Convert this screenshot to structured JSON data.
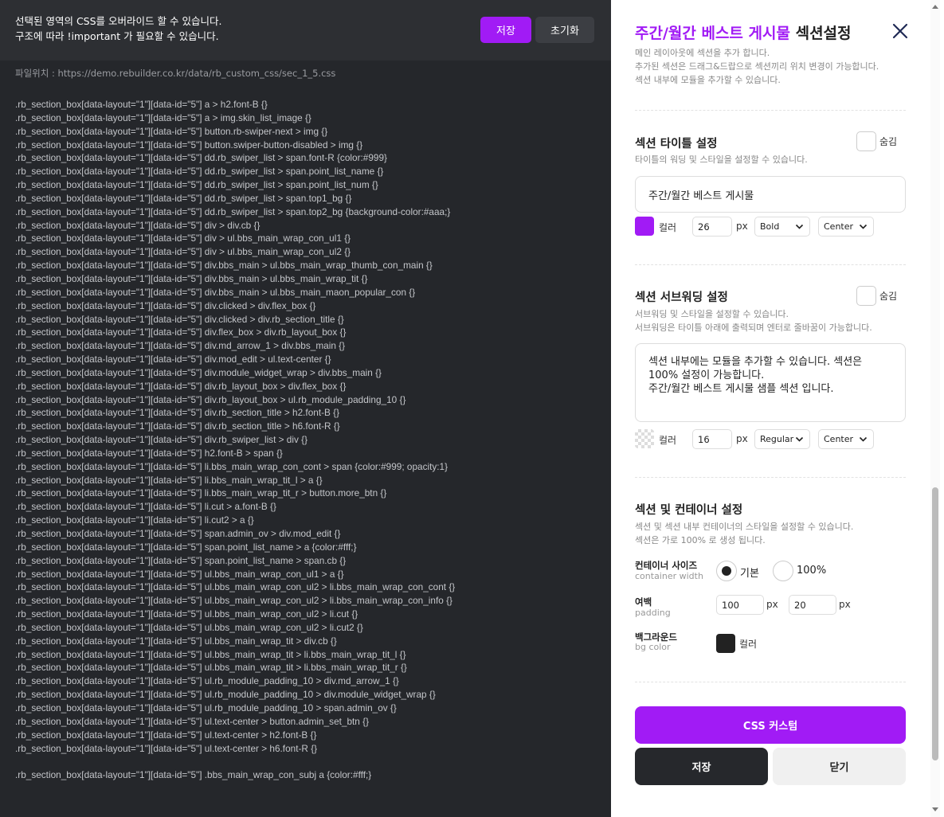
{
  "editor": {
    "notice_line1": "선택된 영역의 CSS를 오버라이드 할 수 있습니다.",
    "notice_line2": "구조에 따라 !important 가 필요할 수 있습니다.",
    "save_label": "저장",
    "reset_label": "초기화",
    "filepath": "파일위치 : https://demo.rebuilder.co.kr/data/rb_custom_css/sec_1_5.css",
    "code_lines": [
      ".rb_section_box[data-layout=\"1\"][data-id=\"5\"] a > h2.font-B {}",
      ".rb_section_box[data-layout=\"1\"][data-id=\"5\"] a > img.skin_list_image {}",
      ".rb_section_box[data-layout=\"1\"][data-id=\"5\"] button.rb-swiper-next > img {}",
      ".rb_section_box[data-layout=\"1\"][data-id=\"5\"] button.swiper-button-disabled > img {}",
      ".rb_section_box[data-layout=\"1\"][data-id=\"5\"] dd.rb_swiper_list > span.font-R {color:#999}",
      ".rb_section_box[data-layout=\"1\"][data-id=\"5\"] dd.rb_swiper_list > span.point_list_name {}",
      ".rb_section_box[data-layout=\"1\"][data-id=\"5\"] dd.rb_swiper_list > span.point_list_num {}",
      ".rb_section_box[data-layout=\"1\"][data-id=\"5\"] dd.rb_swiper_list > span.top1_bg {}",
      ".rb_section_box[data-layout=\"1\"][data-id=\"5\"] dd.rb_swiper_list > span.top2_bg {background-color:#aaa;}",
      ".rb_section_box[data-layout=\"1\"][data-id=\"5\"] div > div.cb {}",
      ".rb_section_box[data-layout=\"1\"][data-id=\"5\"] div > ul.bbs_main_wrap_con_ul1 {}",
      ".rb_section_box[data-layout=\"1\"][data-id=\"5\"] div > ul.bbs_main_wrap_con_ul2 {}",
      ".rb_section_box[data-layout=\"1\"][data-id=\"5\"] div.bbs_main > ul.bbs_main_wrap_thumb_con_main {}",
      ".rb_section_box[data-layout=\"1\"][data-id=\"5\"] div.bbs_main > ul.bbs_main_wrap_tit {}",
      ".rb_section_box[data-layout=\"1\"][data-id=\"5\"] div.bbs_main > ul.bbs_main_maon_popular_con {}",
      ".rb_section_box[data-layout=\"1\"][data-id=\"5\"] div.clicked > div.flex_box {}",
      ".rb_section_box[data-layout=\"1\"][data-id=\"5\"] div.clicked > div.rb_section_title {}",
      ".rb_section_box[data-layout=\"1\"][data-id=\"5\"] div.flex_box > div.rb_layout_box {}",
      ".rb_section_box[data-layout=\"1\"][data-id=\"5\"] div.md_arrow_1 > div.bbs_main {}",
      ".rb_section_box[data-layout=\"1\"][data-id=\"5\"] div.mod_edit > ul.text-center {}",
      ".rb_section_box[data-layout=\"1\"][data-id=\"5\"] div.module_widget_wrap > div.bbs_main {}",
      ".rb_section_box[data-layout=\"1\"][data-id=\"5\"] div.rb_layout_box > div.flex_box {}",
      ".rb_section_box[data-layout=\"1\"][data-id=\"5\"] div.rb_layout_box > ul.rb_module_padding_10 {}",
      ".rb_section_box[data-layout=\"1\"][data-id=\"5\"] div.rb_section_title > h2.font-B {}",
      ".rb_section_box[data-layout=\"1\"][data-id=\"5\"] div.rb_section_title > h6.font-R {}",
      ".rb_section_box[data-layout=\"1\"][data-id=\"5\"] div.rb_swiper_list > div {}",
      ".rb_section_box[data-layout=\"1\"][data-id=\"5\"] h2.font-B > span {}",
      ".rb_section_box[data-layout=\"1\"][data-id=\"5\"] li.bbs_main_wrap_con_cont > span {color:#999; opacity:1}",
      ".rb_section_box[data-layout=\"1\"][data-id=\"5\"] li.bbs_main_wrap_tit_l > a {}",
      ".rb_section_box[data-layout=\"1\"][data-id=\"5\"] li.bbs_main_wrap_tit_r > button.more_btn {}",
      ".rb_section_box[data-layout=\"1\"][data-id=\"5\"] li.cut > a.font-B {}",
      ".rb_section_box[data-layout=\"1\"][data-id=\"5\"] li.cut2 > a {}",
      ".rb_section_box[data-layout=\"1\"][data-id=\"5\"] span.admin_ov > div.mod_edit {}",
      ".rb_section_box[data-layout=\"1\"][data-id=\"5\"] span.point_list_name > a {color:#fff;}",
      ".rb_section_box[data-layout=\"1\"][data-id=\"5\"] span.point_list_name > span.cb {}",
      ".rb_section_box[data-layout=\"1\"][data-id=\"5\"] ul.bbs_main_wrap_con_ul1 > a {}",
      ".rb_section_box[data-layout=\"1\"][data-id=\"5\"] ul.bbs_main_wrap_con_ul2 > li.bbs_main_wrap_con_cont {}",
      ".rb_section_box[data-layout=\"1\"][data-id=\"5\"] ul.bbs_main_wrap_con_ul2 > li.bbs_main_wrap_con_info {}",
      ".rb_section_box[data-layout=\"1\"][data-id=\"5\"] ul.bbs_main_wrap_con_ul2 > li.cut {}",
      ".rb_section_box[data-layout=\"1\"][data-id=\"5\"] ul.bbs_main_wrap_con_ul2 > li.cut2 {}",
      ".rb_section_box[data-layout=\"1\"][data-id=\"5\"] ul.bbs_main_wrap_tit > div.cb {}",
      ".rb_section_box[data-layout=\"1\"][data-id=\"5\"] ul.bbs_main_wrap_tit > li.bbs_main_wrap_tit_l {}",
      ".rb_section_box[data-layout=\"1\"][data-id=\"5\"] ul.bbs_main_wrap_tit > li.bbs_main_wrap_tit_r {}",
      ".rb_section_box[data-layout=\"1\"][data-id=\"5\"] ul.rb_module_padding_10 > div.md_arrow_1 {}",
      ".rb_section_box[data-layout=\"1\"][data-id=\"5\"] ul.rb_module_padding_10 > div.module_widget_wrap {}",
      ".rb_section_box[data-layout=\"1\"][data-id=\"5\"] ul.rb_module_padding_10 > span.admin_ov {}",
      ".rb_section_box[data-layout=\"1\"][data-id=\"5\"] ul.text-center > button.admin_set_btn {}",
      ".rb_section_box[data-layout=\"1\"][data-id=\"5\"] ul.text-center > h2.font-B {}",
      ".rb_section_box[data-layout=\"1\"][data-id=\"5\"] ul.text-center > h6.font-R {}",
      "",
      ".rb_section_box[data-layout=\"1\"][data-id=\"5\"] .bbs_main_wrap_con_subj a {color:#fff;}"
    ]
  },
  "panel": {
    "title_accent": "주간/월간 베스트 게시물",
    "title_rest": " 섹션설정",
    "desc": [
      "메인 레이아웃에 섹션을 추가 합니다.",
      "추가된 섹션은 드래그&드랍으로 섹션끼리 위치 변경이 가능합니다.",
      "섹션 내부에 모듈을 추가할 수 있습니다."
    ],
    "title_section": {
      "heading": "섹션 타이틀 설정",
      "hide_label": "숨김",
      "desc": "타이틀의 워딩 및 스타일을 설정할 수 있습니다.",
      "value": "주간/월간 베스트 게시물",
      "color_label": "컬러",
      "color": "#a11bf5",
      "size": "26",
      "unit": "px",
      "weight": "Bold",
      "align": "Center"
    },
    "subtitle_section": {
      "heading": "섹션 서브워딩 설정",
      "hide_label": "숨김",
      "desc": [
        "서브워딩 및 스타일을 설정할 수 있습니다.",
        "서브워딩은 타이틀 아래에 출력되며 엔터로 줄바꿈이 가능합니다."
      ],
      "value": [
        "섹션 내부에는 모듈을 추가할 수 있습니다. 섹션은 100% 설정이 가능합니다.",
        "주간/월간 베스트 게시물 샘플 섹션 입니다."
      ],
      "color_label": "컬러",
      "size": "16",
      "unit": "px",
      "weight": "Regular",
      "align": "Center"
    },
    "container_section": {
      "heading": "섹션 및 컨테이너 설정",
      "desc": [
        "섹션 및 섹션 내부 컨테이너의 스타일을 설정할 수 있습니다.",
        "섹션은 가로 100% 로 생성 됩니다."
      ],
      "size_label": "컨테이너 사이즈",
      "size_sub": "container width",
      "opt_basic": "기본",
      "opt_full": "100%",
      "padding_label": "여백",
      "padding_sub": "padding",
      "padding_1": "100",
      "padding_2": "20",
      "unit": "px",
      "bg_label": "백그라운드",
      "bg_sub": "bg color",
      "bg_color_label": "컬러",
      "bg_color": "#222222"
    },
    "css_custom_label": "CSS 커스텀",
    "save_label": "저장",
    "close_label": "닫기"
  }
}
